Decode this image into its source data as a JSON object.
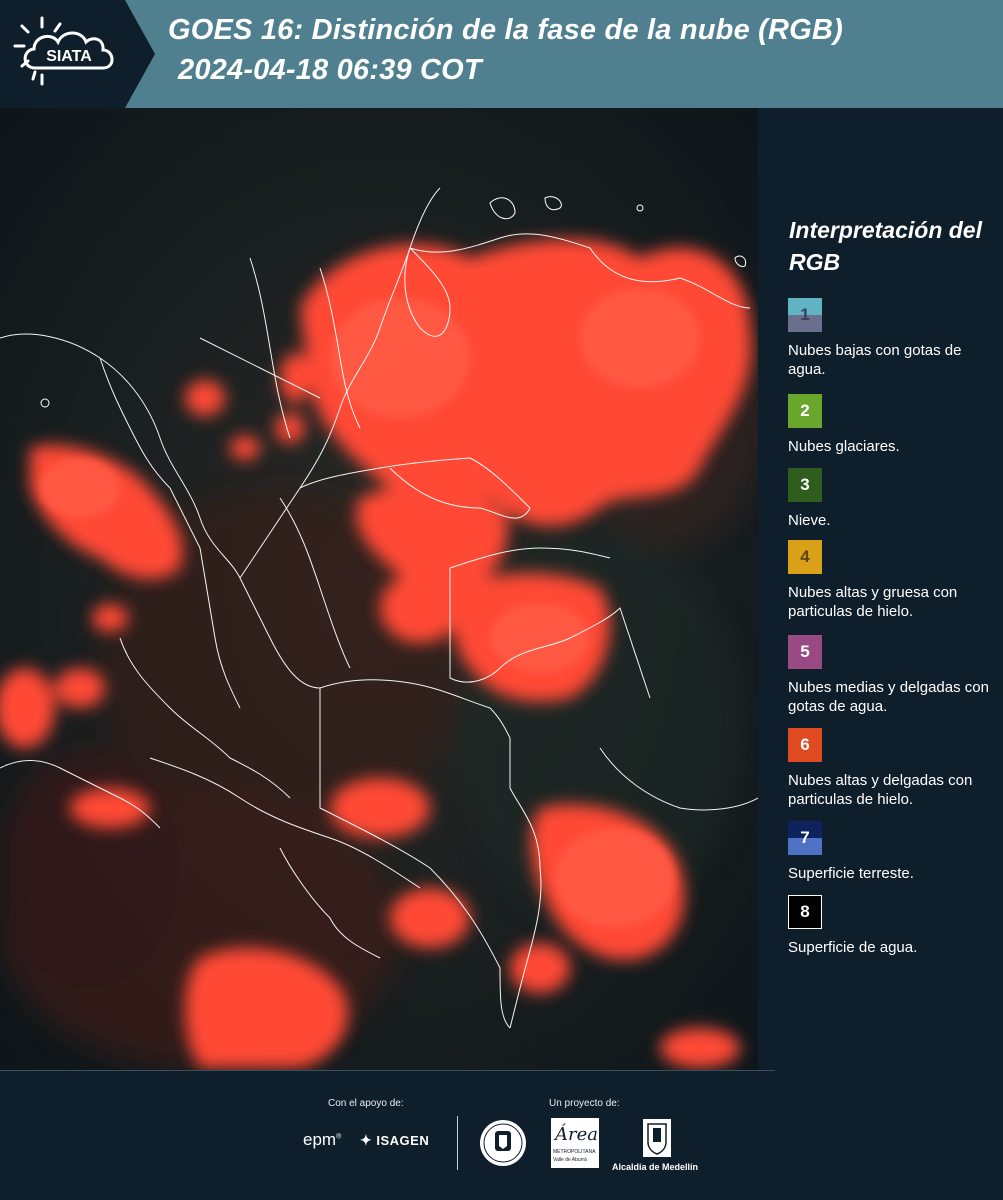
{
  "header": {
    "logo_text": "SIATA",
    "title_line1": "GOES 16: Distinción de la fase de la nube (RGB)",
    "title_line2": "2024-04-18 06:39 COT",
    "background": "#50808f"
  },
  "legend": {
    "title": "Interpretación del RGB",
    "items": [
      {
        "number": "1",
        "label": "Nubes bajas con gotas de agua.",
        "color_top": "#5fb3c3",
        "color_bottom": "#6a6f8e"
      },
      {
        "number": "2",
        "label": "Nubes glaciares.",
        "color_top": "#6aa52c",
        "color_bottom": "#6aa52c"
      },
      {
        "number": "3",
        "label": "Nieve.",
        "color_top": "#2f5d1d",
        "color_bottom": "#2f5d1d"
      },
      {
        "number": "4",
        "label": "Nubes altas y gruesa con particulas de hielo.",
        "color_top": "#d9a018",
        "color_bottom": "#d9a018"
      },
      {
        "number": "5",
        "label": "Nubes medias y delgadas con gotas de agua.",
        "color_top": "#9a4a83",
        "color_bottom": "#9a4a83"
      },
      {
        "number": "6",
        "label": "Nubes altas y delgadas con particulas de hielo.",
        "color_top": "#e04a22",
        "color_bottom": "#e04a22"
      },
      {
        "number": "7",
        "label": "Superficie terreste.",
        "color_top": "#0e2260",
        "color_bottom": "#4e73c4"
      },
      {
        "number": "8",
        "label": "Superficie de agua.",
        "color_top": "#000000",
        "color_bottom": "#000000"
      }
    ]
  },
  "footer": {
    "support_label": "Con el apoyo de:",
    "project_label": "Un proyecto de:",
    "partners": {
      "epm": "epm",
      "isagen": "ISAGEN",
      "area_top": "Área",
      "area_sub1": "METROPOLITANA",
      "area_sub2": "Valle de Aburrá",
      "alcaldia": "Alcaldía de Medellín"
    }
  }
}
